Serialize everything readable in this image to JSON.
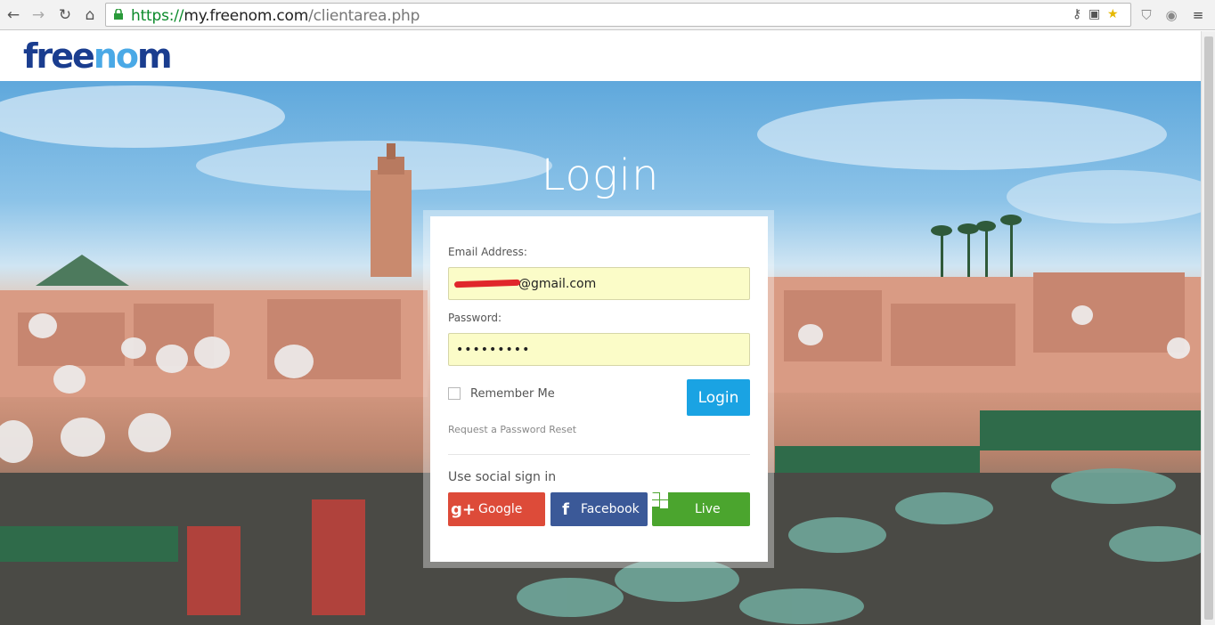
{
  "browser": {
    "url_scheme": "https://",
    "url_host": "my.freenom.com",
    "url_path": "/clientarea.php"
  },
  "site": {
    "logo_left": "free",
    "logo_o": "no",
    "logo_right": "m"
  },
  "hero": {
    "title": "Login"
  },
  "form": {
    "email_label": "Email Address:",
    "email_value": "@gmail.com",
    "password_label": "Password:",
    "password_value": "•••••••••",
    "remember_label": "Remember Me",
    "login_label": "Login",
    "reset_link": "Request a Password Reset",
    "social_title": "Use social sign in",
    "google_label": "Google",
    "facebook_label": "Facebook",
    "live_label": "Live"
  },
  "colors": {
    "brand_blue": "#1a3d8f",
    "accent": "#1aa3e3",
    "google": "#dd4b39",
    "facebook": "#3b5998",
    "live": "#4ba52e",
    "autofill": "#fbfcc8"
  }
}
